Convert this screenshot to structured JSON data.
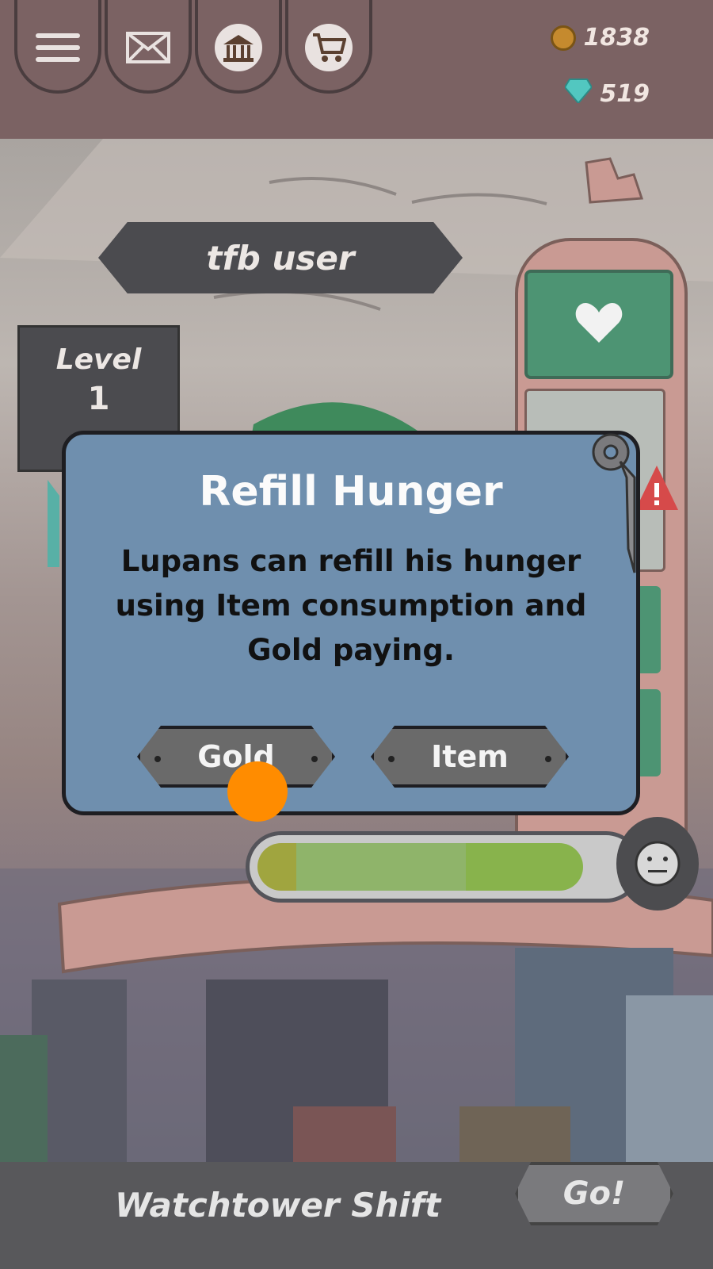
{
  "header": {
    "currency": {
      "gold": "1838",
      "gems": "519",
      "gold_icon": "coin-icon",
      "gem_icon": "gem-icon"
    },
    "nav_icons": [
      "menu-icon",
      "mail-icon",
      "building-icon",
      "cart-icon"
    ]
  },
  "player": {
    "name": "tfb user",
    "level_label": "Level",
    "level_value": "1"
  },
  "dialog": {
    "title": "Refill Hunger",
    "body": "Lupans can refill his hunger using Item consumption and Gold paying.",
    "buttons": {
      "gold": "Gold",
      "item": "Item"
    }
  },
  "status": {
    "hunger_fill": 0.86
  },
  "footer": {
    "task_label": "Watchtower Shift",
    "go_label": "Go!"
  },
  "colors": {
    "dialog_bg": "#6f8fae",
    "tap_marker": "#ff8c00",
    "meter_green": "#8fbd65",
    "panel_green": "#4d9473"
  }
}
